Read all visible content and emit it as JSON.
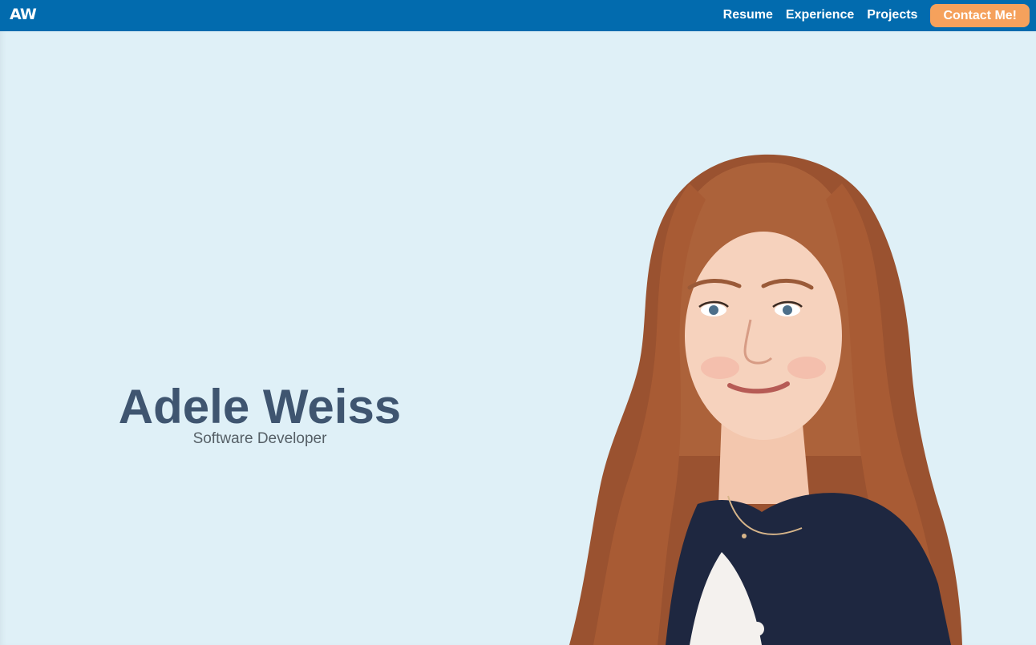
{
  "header": {
    "logo": "AW",
    "nav": [
      "Resume",
      "Experience",
      "Projects"
    ],
    "cta": "Contact Me!"
  },
  "hero": {
    "name": "Adele Weiss",
    "role": "Software Developer"
  },
  "colors": {
    "navbar": "#026bae",
    "cta": "#f5a15c",
    "background": "#dff0f7",
    "name": "#3f5570"
  }
}
